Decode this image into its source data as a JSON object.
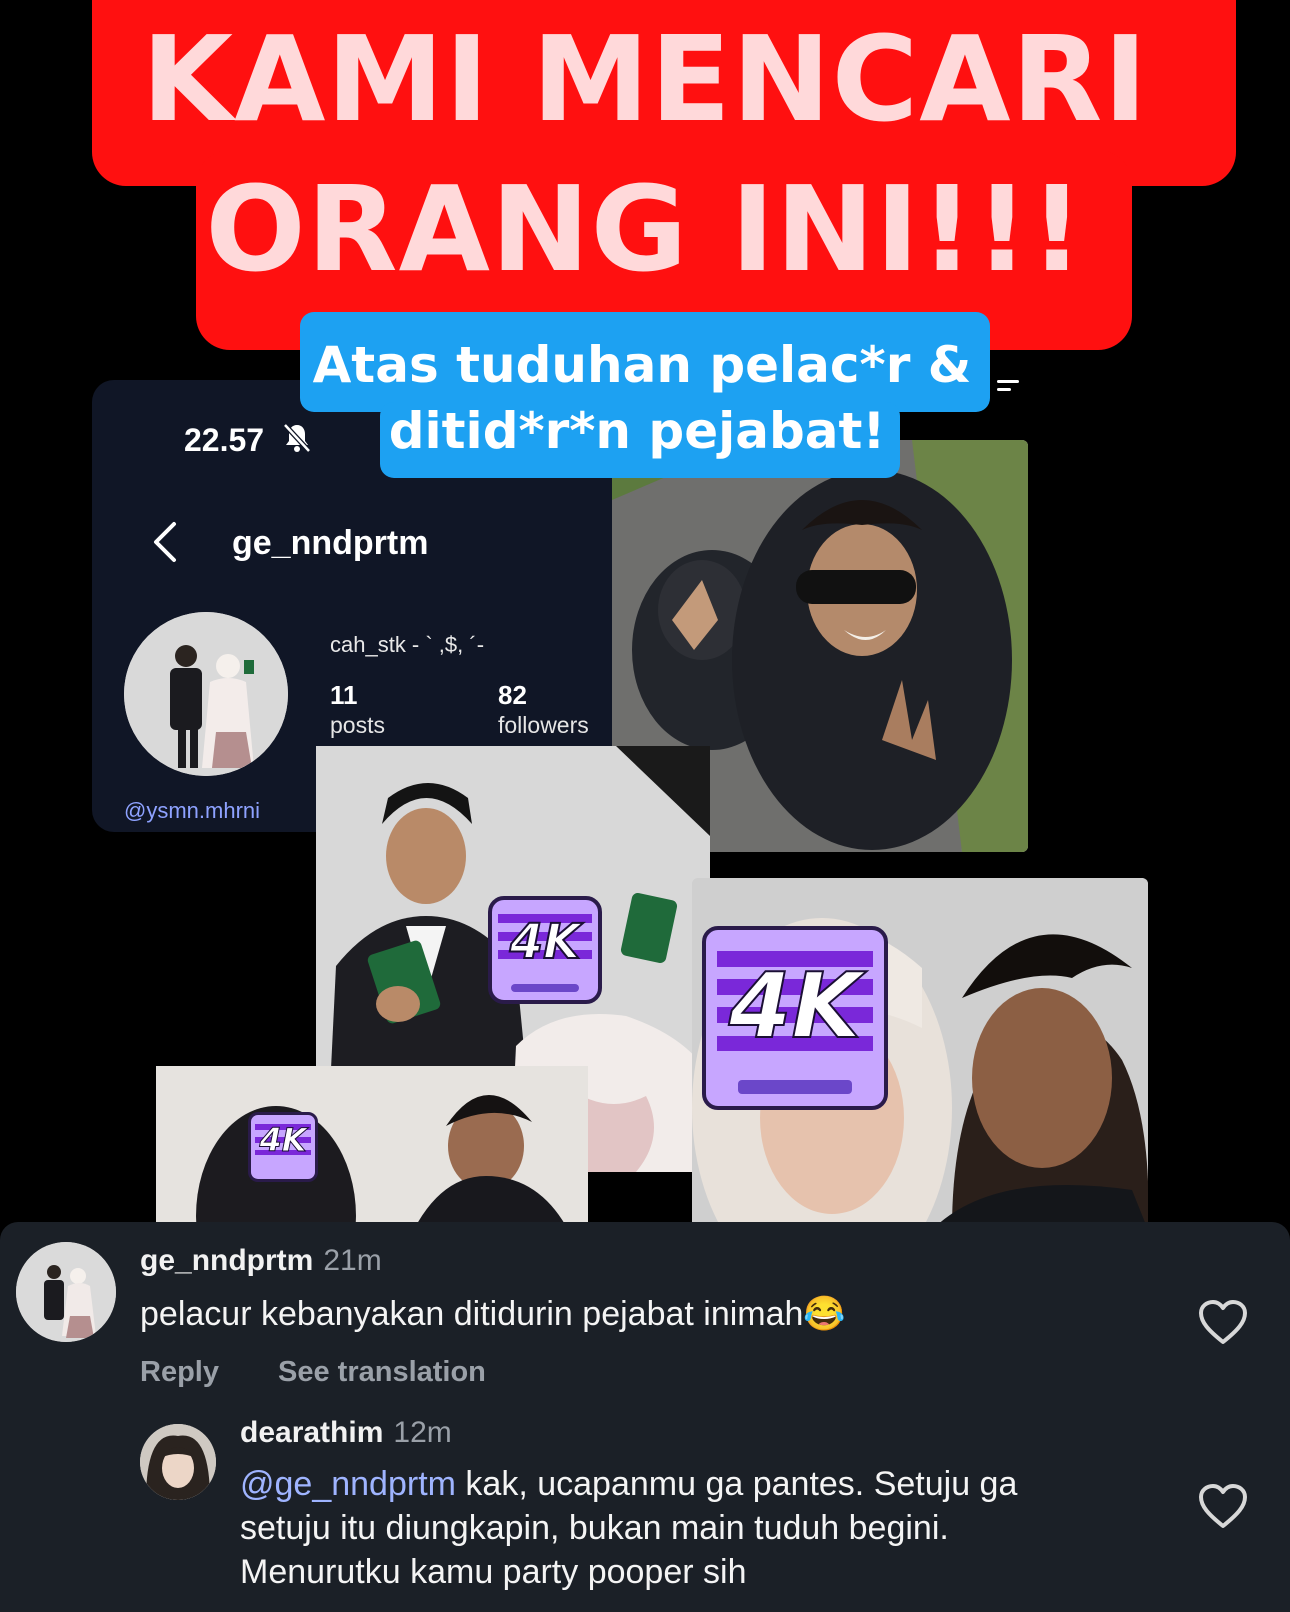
{
  "headline": {
    "line1": "KAMI MENCARI",
    "line2": "ORANG INI!!!",
    "sub_line1": "Atas tuduhan pelac*r &",
    "sub_line2": "ditid*r*n pejabat!"
  },
  "profile": {
    "time": "22.57",
    "username": "ge_nndprtm",
    "display_name": "cah_stk - ` ,$, ´-",
    "posts_count": "11",
    "posts_label": "posts",
    "followers_count": "82",
    "followers_label": "followers",
    "tagged_link": "@ysmn.mhrni"
  },
  "stickers": {
    "label": "4K"
  },
  "comments": [
    {
      "username": "ge_nndprtm",
      "time": "21m",
      "text": "pelacur kebanyakan ditidurin pejabat inimah😂",
      "reply_label": "Reply",
      "translate_label": "See translation"
    },
    {
      "username": "dearathim",
      "time": "12m",
      "mention": "@ge_nndprtm",
      "text_line1": " kak, ucapanmu ga pantes. Setuju ga",
      "text_line2": "setuju itu diungkapin, bukan main tuduh begini.",
      "text_line3": "Menurutku kamu party pooper sih"
    }
  ],
  "colors": {
    "headline_bg": "#ff1010",
    "headline_text": "#ffd9da",
    "subtitle_bg": "#1da1f2",
    "card_bg": "#101626",
    "comments_bg": "#1b2027",
    "mention": "#9fb4ff"
  },
  "icons": [
    "bell-off-icon",
    "back-chevron-icon",
    "heart-icon",
    "menu-icon"
  ]
}
